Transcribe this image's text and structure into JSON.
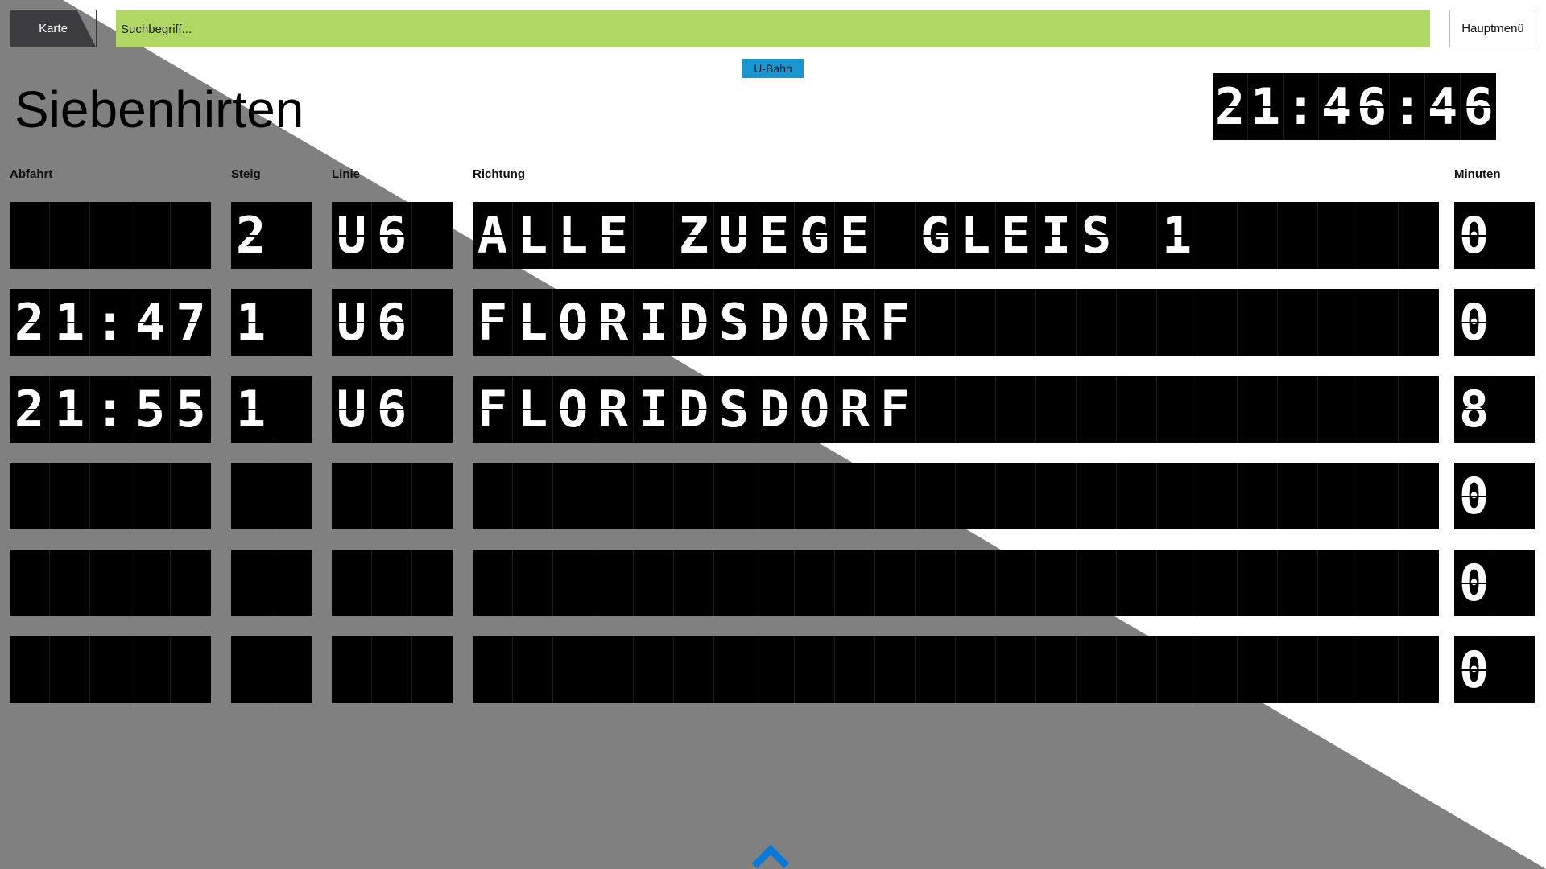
{
  "toolbar": {
    "map_label": "Karte",
    "search_placeholder": "Suchbegriff...",
    "menu_label": "Hauptmenü"
  },
  "filter": {
    "transport_type": "U-Bahn"
  },
  "station": {
    "name": "Siebenhirten"
  },
  "clock": {
    "time": "21:46:46"
  },
  "table": {
    "headers": {
      "departure": "Abfahrt",
      "platform": "Steig",
      "line": "Linie",
      "direction": "Richtung",
      "minutes": "Minuten"
    },
    "rows": [
      {
        "departure": "",
        "platform": "2",
        "line": "U6",
        "direction": "ALLE ZUEGE GLEIS 1",
        "minutes": "0"
      },
      {
        "departure": "21:47",
        "platform": "1",
        "line": "U6",
        "direction": "FLORIDSDORF",
        "minutes": "0"
      },
      {
        "departure": "21:55",
        "platform": "1",
        "line": "U6",
        "direction": "FLORIDSDORF",
        "minutes": "8"
      },
      {
        "departure": "",
        "platform": "",
        "line": "",
        "direction": "",
        "minutes": "0"
      },
      {
        "departure": "",
        "platform": "",
        "line": "",
        "direction": "",
        "minutes": "0"
      },
      {
        "departure": "",
        "platform": "",
        "line": "",
        "direction": "",
        "minutes": "0"
      }
    ]
  },
  "icons": {
    "scroll_up": "chevron-up-icon"
  },
  "colors": {
    "search_bg": "#b0d763",
    "tag_bg": "#1b95cf",
    "board_bg": "#000000",
    "overlay_gray": "#808080",
    "chevron": "#0a78d4"
  }
}
